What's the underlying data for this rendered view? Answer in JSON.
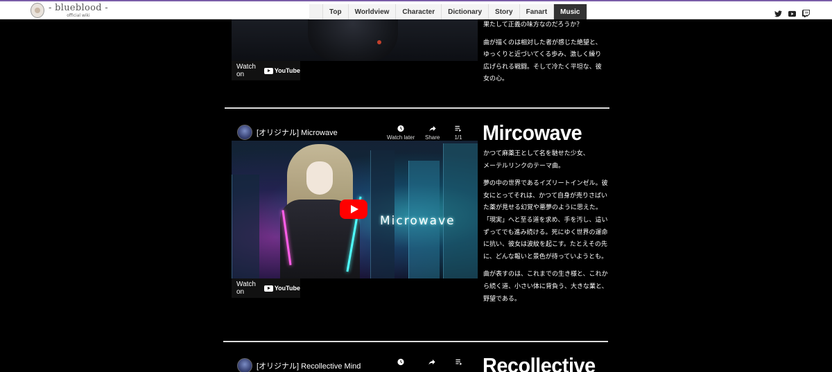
{
  "header": {
    "logo_title": "- blueblood -",
    "logo_sub": "official wiki",
    "nav": [
      "Top",
      "Worldview",
      "Character",
      "Dictionary",
      "Story",
      "Fanart",
      "Music"
    ],
    "active_nav": "Music",
    "social_icons": [
      "twitter-icon",
      "youtube-icon",
      "twitch-icon"
    ]
  },
  "section1": {
    "watch_label": "Watch on",
    "yt_label": "YouTube",
    "text": [
      "果たして正義の味方なのだろうか？",
      "曲が描くのは相対した者が感じた絶望と、ゆっくりと近づいてくる歩み、激しく繰り広げられる戦闘。そして冷たく平坦な、彼女の心。"
    ]
  },
  "section2": {
    "video_title": "[オリジナル] Microwave",
    "watch_later": "Watch later",
    "share": "Share",
    "playlist_count": "1/1",
    "thumb_word": "Microwave",
    "watch_label": "Watch on",
    "yt_label": "YouTube",
    "song_title": "Mircowave",
    "text": [
      "かつて麻薬王として名を馳せた少女、メーテルリンクのテーマ曲。",
      "夢の中の世界であるイズリートインゼル。彼女にとってそれは、かつて自身が売りさばいた薬が見せる幻覚や悪夢のように思えた。",
      "「現実」へと至る道を求め、手を汚し、這いずってでも進み続ける。死にゆく世界の運命に抗い、彼女は波紋を起こす。たとえその先に、どんな報いと景色が待っていようとも。",
      "曲が表すのは、これまでの生き様と、これから続く道、小さい体に背負う、大きな業と、野望である。"
    ]
  },
  "section3": {
    "video_title": "[オリジナル] Recollective Mind",
    "song_title": "Recollective"
  },
  "colors": {
    "accent_bar": "#7a5da8",
    "youtube_red": "#ff0000",
    "background": "#000000"
  }
}
